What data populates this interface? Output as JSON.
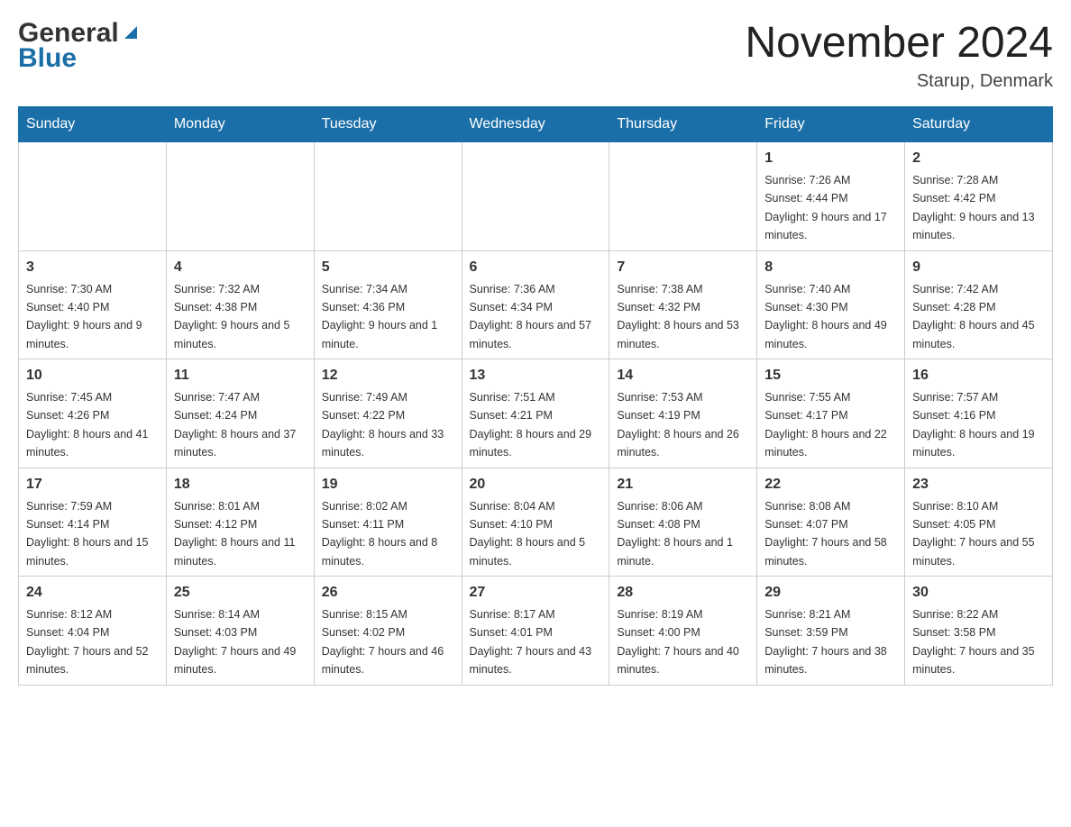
{
  "header": {
    "logo_general": "General",
    "logo_blue": "Blue",
    "title": "November 2024",
    "subtitle": "Starup, Denmark"
  },
  "days_of_week": [
    "Sunday",
    "Monday",
    "Tuesday",
    "Wednesday",
    "Thursday",
    "Friday",
    "Saturday"
  ],
  "weeks": [
    [
      {
        "day": "",
        "info": ""
      },
      {
        "day": "",
        "info": ""
      },
      {
        "day": "",
        "info": ""
      },
      {
        "day": "",
        "info": ""
      },
      {
        "day": "",
        "info": ""
      },
      {
        "day": "1",
        "info": "Sunrise: 7:26 AM\nSunset: 4:44 PM\nDaylight: 9 hours and 17 minutes."
      },
      {
        "day": "2",
        "info": "Sunrise: 7:28 AM\nSunset: 4:42 PM\nDaylight: 9 hours and 13 minutes."
      }
    ],
    [
      {
        "day": "3",
        "info": "Sunrise: 7:30 AM\nSunset: 4:40 PM\nDaylight: 9 hours and 9 minutes."
      },
      {
        "day": "4",
        "info": "Sunrise: 7:32 AM\nSunset: 4:38 PM\nDaylight: 9 hours and 5 minutes."
      },
      {
        "day": "5",
        "info": "Sunrise: 7:34 AM\nSunset: 4:36 PM\nDaylight: 9 hours and 1 minute."
      },
      {
        "day": "6",
        "info": "Sunrise: 7:36 AM\nSunset: 4:34 PM\nDaylight: 8 hours and 57 minutes."
      },
      {
        "day": "7",
        "info": "Sunrise: 7:38 AM\nSunset: 4:32 PM\nDaylight: 8 hours and 53 minutes."
      },
      {
        "day": "8",
        "info": "Sunrise: 7:40 AM\nSunset: 4:30 PM\nDaylight: 8 hours and 49 minutes."
      },
      {
        "day": "9",
        "info": "Sunrise: 7:42 AM\nSunset: 4:28 PM\nDaylight: 8 hours and 45 minutes."
      }
    ],
    [
      {
        "day": "10",
        "info": "Sunrise: 7:45 AM\nSunset: 4:26 PM\nDaylight: 8 hours and 41 minutes."
      },
      {
        "day": "11",
        "info": "Sunrise: 7:47 AM\nSunset: 4:24 PM\nDaylight: 8 hours and 37 minutes."
      },
      {
        "day": "12",
        "info": "Sunrise: 7:49 AM\nSunset: 4:22 PM\nDaylight: 8 hours and 33 minutes."
      },
      {
        "day": "13",
        "info": "Sunrise: 7:51 AM\nSunset: 4:21 PM\nDaylight: 8 hours and 29 minutes."
      },
      {
        "day": "14",
        "info": "Sunrise: 7:53 AM\nSunset: 4:19 PM\nDaylight: 8 hours and 26 minutes."
      },
      {
        "day": "15",
        "info": "Sunrise: 7:55 AM\nSunset: 4:17 PM\nDaylight: 8 hours and 22 minutes."
      },
      {
        "day": "16",
        "info": "Sunrise: 7:57 AM\nSunset: 4:16 PM\nDaylight: 8 hours and 19 minutes."
      }
    ],
    [
      {
        "day": "17",
        "info": "Sunrise: 7:59 AM\nSunset: 4:14 PM\nDaylight: 8 hours and 15 minutes."
      },
      {
        "day": "18",
        "info": "Sunrise: 8:01 AM\nSunset: 4:12 PM\nDaylight: 8 hours and 11 minutes."
      },
      {
        "day": "19",
        "info": "Sunrise: 8:02 AM\nSunset: 4:11 PM\nDaylight: 8 hours and 8 minutes."
      },
      {
        "day": "20",
        "info": "Sunrise: 8:04 AM\nSunset: 4:10 PM\nDaylight: 8 hours and 5 minutes."
      },
      {
        "day": "21",
        "info": "Sunrise: 8:06 AM\nSunset: 4:08 PM\nDaylight: 8 hours and 1 minute."
      },
      {
        "day": "22",
        "info": "Sunrise: 8:08 AM\nSunset: 4:07 PM\nDaylight: 7 hours and 58 minutes."
      },
      {
        "day": "23",
        "info": "Sunrise: 8:10 AM\nSunset: 4:05 PM\nDaylight: 7 hours and 55 minutes."
      }
    ],
    [
      {
        "day": "24",
        "info": "Sunrise: 8:12 AM\nSunset: 4:04 PM\nDaylight: 7 hours and 52 minutes."
      },
      {
        "day": "25",
        "info": "Sunrise: 8:14 AM\nSunset: 4:03 PM\nDaylight: 7 hours and 49 minutes."
      },
      {
        "day": "26",
        "info": "Sunrise: 8:15 AM\nSunset: 4:02 PM\nDaylight: 7 hours and 46 minutes."
      },
      {
        "day": "27",
        "info": "Sunrise: 8:17 AM\nSunset: 4:01 PM\nDaylight: 7 hours and 43 minutes."
      },
      {
        "day": "28",
        "info": "Sunrise: 8:19 AM\nSunset: 4:00 PM\nDaylight: 7 hours and 40 minutes."
      },
      {
        "day": "29",
        "info": "Sunrise: 8:21 AM\nSunset: 3:59 PM\nDaylight: 7 hours and 38 minutes."
      },
      {
        "day": "30",
        "info": "Sunrise: 8:22 AM\nSunset: 3:58 PM\nDaylight: 7 hours and 35 minutes."
      }
    ]
  ]
}
